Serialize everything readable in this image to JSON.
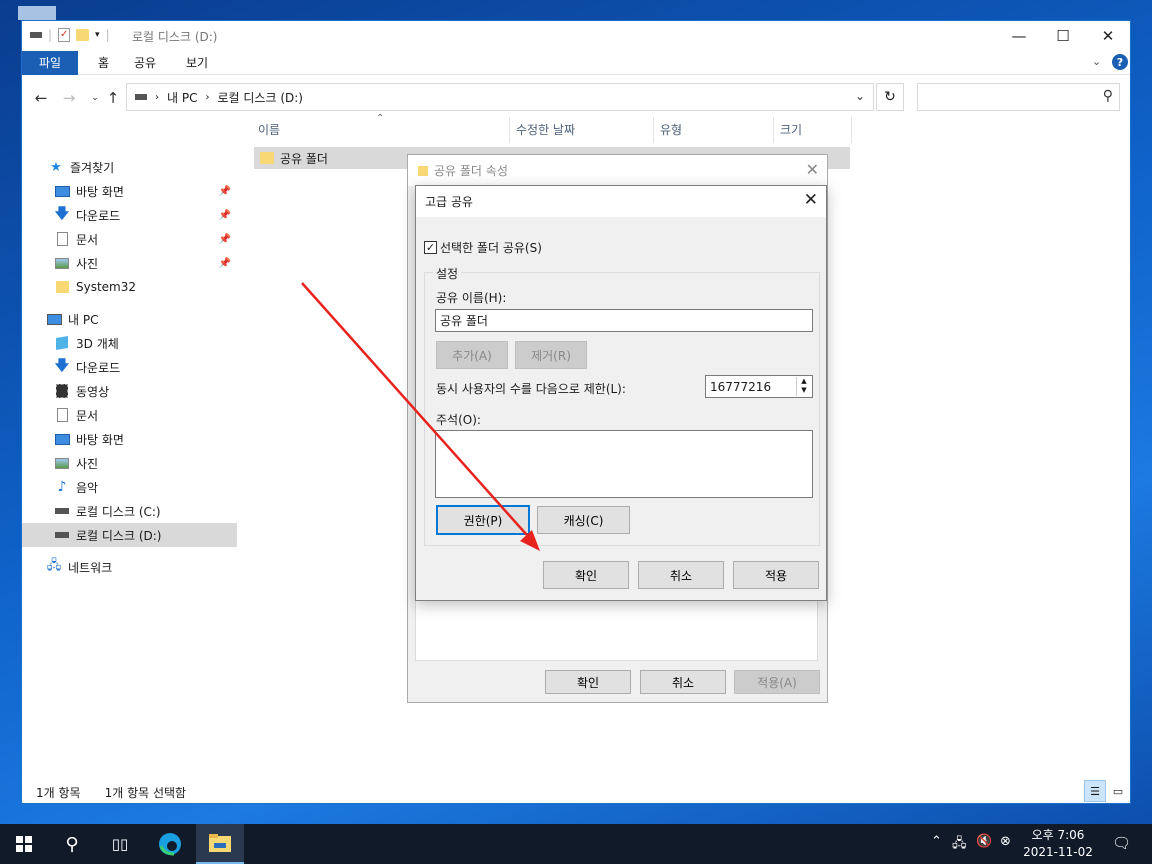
{
  "explorer": {
    "title": "로컬 디스크 (D:)",
    "window_controls": {
      "minimize": "—",
      "maximize": "☐",
      "close": "✕"
    },
    "ribbon_tabs": [
      "파일",
      "홈",
      "공유",
      "보기"
    ],
    "address": {
      "crumbs": [
        "내 PC",
        "로컬 디스크 (D:)"
      ]
    },
    "sidebar": [
      {
        "label": "즐겨찾기",
        "icon": "star-icon"
      },
      {
        "label": "바탕 화면",
        "icon": "desktop-icon"
      },
      {
        "label": "다운로드",
        "icon": "download-icon"
      },
      {
        "label": "문서",
        "icon": "document-icon"
      },
      {
        "label": "사진",
        "icon": "picture-icon"
      },
      {
        "label": "System32",
        "icon": "folder-icon"
      },
      {
        "label": "내 PC",
        "icon": "computer-icon"
      },
      {
        "label": "3D 개체",
        "icon": "cube-icon"
      },
      {
        "label": "다운로드",
        "icon": "download-icon"
      },
      {
        "label": "동영상",
        "icon": "video-icon"
      },
      {
        "label": "문서",
        "icon": "document-icon"
      },
      {
        "label": "바탕 화면",
        "icon": "desktop-icon"
      },
      {
        "label": "사진",
        "icon": "picture-icon"
      },
      {
        "label": "음악",
        "icon": "music-icon"
      },
      {
        "label": "로컬 디스크 (C:)",
        "icon": "drive-icon"
      },
      {
        "label": "로컬 디스크 (D:)",
        "icon": "drive-icon"
      },
      {
        "label": "네트워크",
        "icon": "network-icon"
      }
    ],
    "columns": [
      "이름",
      "수정한 날짜",
      "유형",
      "크기"
    ],
    "file": {
      "name": "공유 폴더"
    },
    "status": {
      "count": "1개 항목",
      "selected": "1개 항목 선택함"
    }
  },
  "props_dialog": {
    "title": "공유 폴더 속성",
    "ok": "확인",
    "cancel": "취소",
    "apply": "적용(A)"
  },
  "adv_dialog": {
    "title": "고급 공유",
    "share_checkbox": "선택한 폴더 공유(S)",
    "settings_legend": "설정",
    "share_name_label": "공유 이름(H):",
    "share_name_value": "공유 폴더",
    "add": "추가(A)",
    "remove": "제거(R)",
    "limit_label": "동시 사용자의 수를 다음으로 제한(L):",
    "limit_value": "16777216",
    "comment_label": "주석(O):",
    "permissions": "권한(P)",
    "caching": "캐싱(C)",
    "ok": "확인",
    "cancel": "취소",
    "apply": "적용"
  },
  "taskbar": {
    "time": "오후 7:06",
    "date": "2021-11-02"
  },
  "colors": {
    "accent": "#1a5fb4",
    "arrow": "#e8231f",
    "taskbar": "#101a29"
  }
}
